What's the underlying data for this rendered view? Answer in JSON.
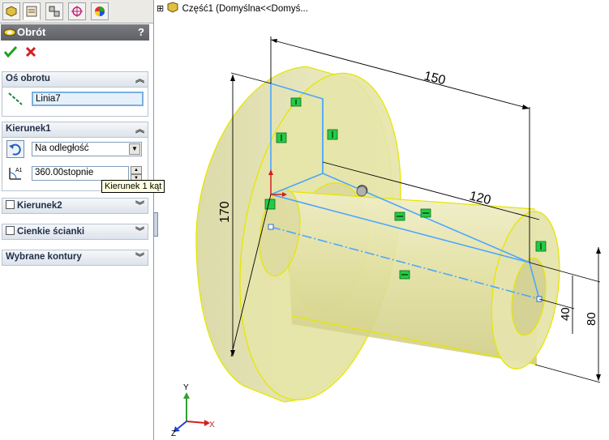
{
  "tree": {
    "expander": "⊞",
    "part_label": "Część1  (Domyślna<<Domyś..."
  },
  "panel": {
    "title": "Obrót",
    "help": "?",
    "ok_icon": "check-icon",
    "cancel_icon": "x-icon",
    "axis": {
      "header": "Oś obrotu",
      "value": "Linia7"
    },
    "dir1": {
      "header": "Kierunek1",
      "type_value": "Na odległość",
      "angle_value": "360.00stopnie"
    },
    "dir2": {
      "header": "Kierunek2"
    },
    "thin": {
      "header": "Cienkie ścianki"
    },
    "contours": {
      "header": "Wybrane kontury"
    }
  },
  "tooltip": "Kierunek 1 kąt",
  "dimensions": {
    "d150": "150",
    "d120": "120",
    "d170": "170",
    "d40": "40",
    "d80": "80"
  },
  "triad": {
    "x": "X",
    "y": "Y",
    "z": "Z"
  },
  "colors": {
    "model_fill": "#e8e6a0",
    "model_edge": "#f0f000",
    "sketch": "#4da6ff",
    "relation": "#22cc44"
  }
}
